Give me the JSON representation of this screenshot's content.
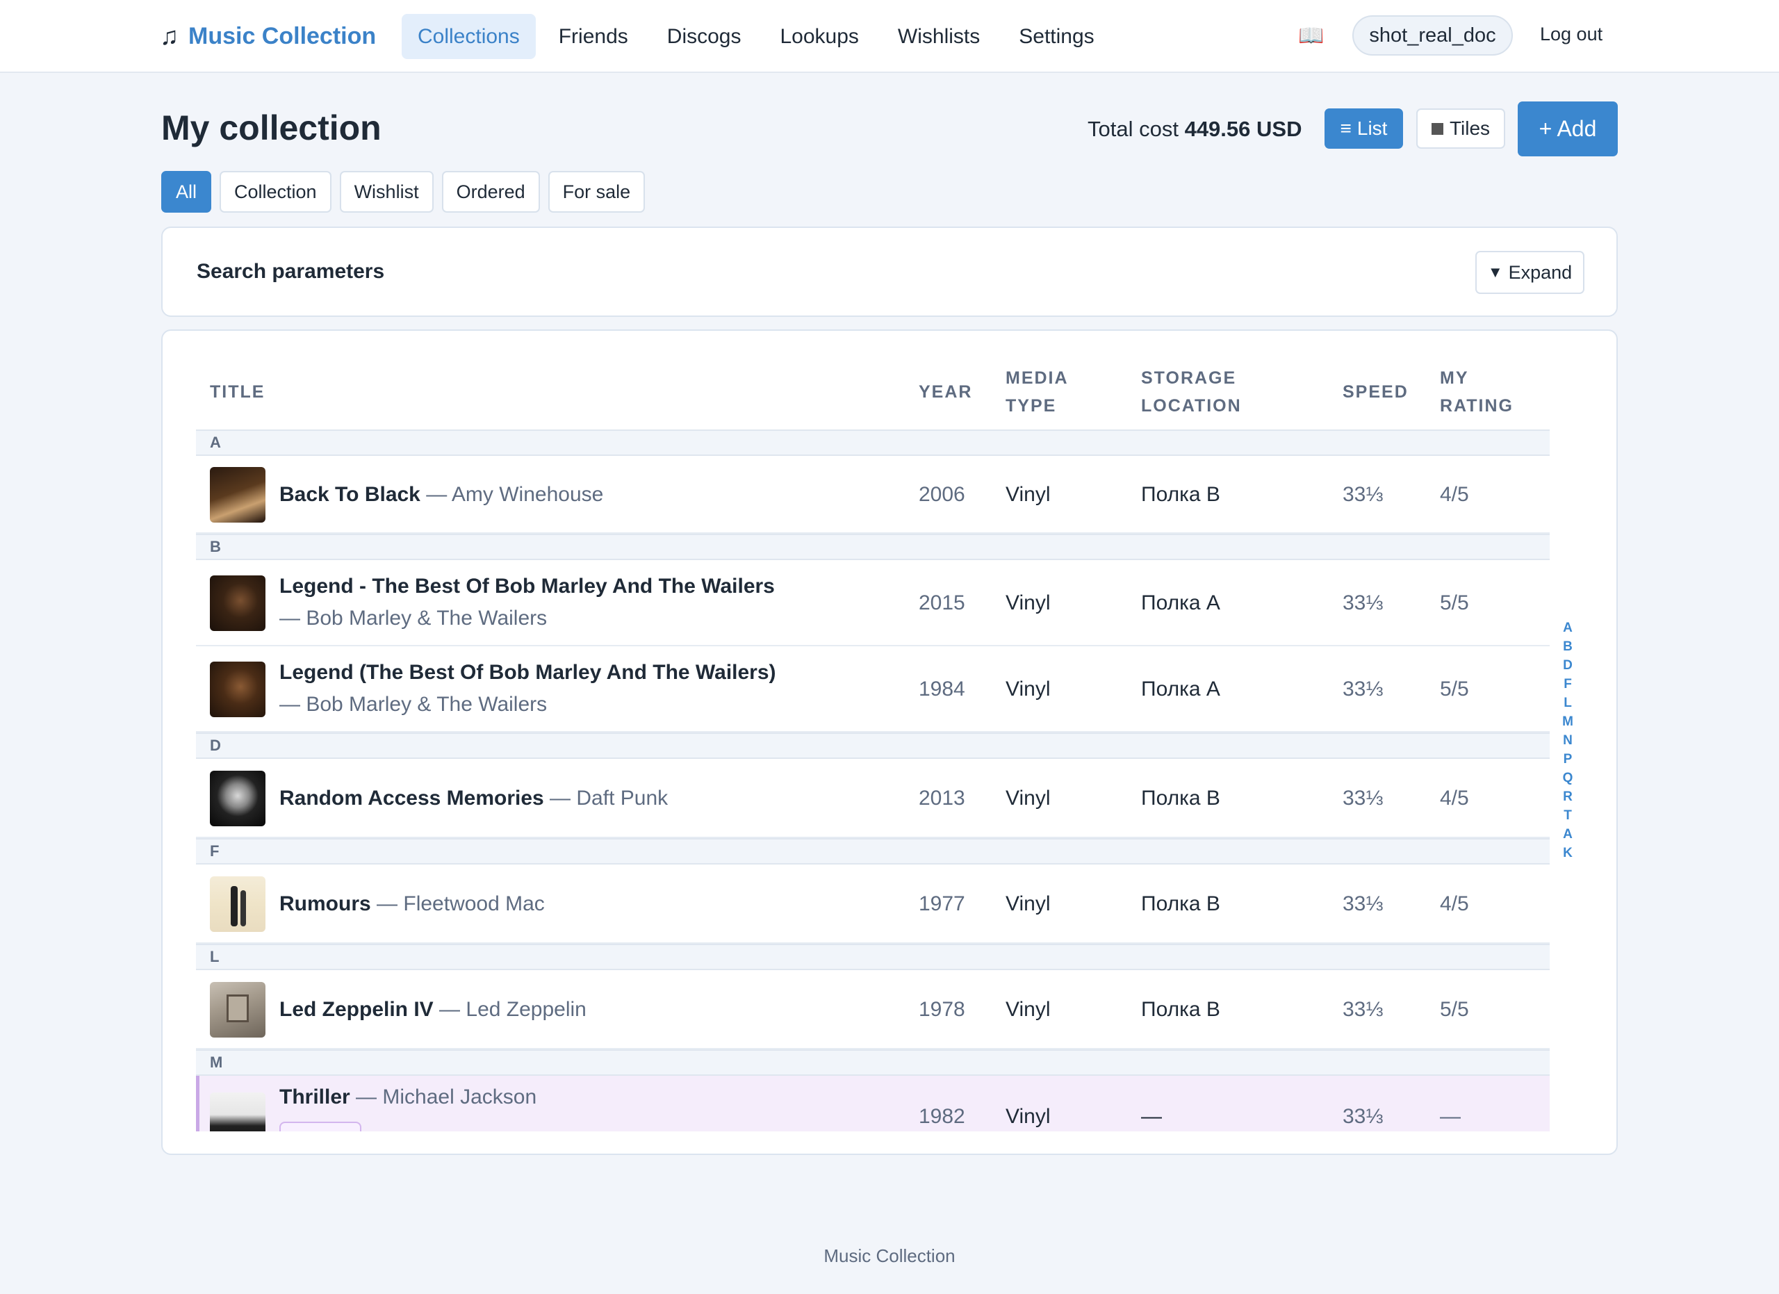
{
  "app": {
    "brand": "Music Collection",
    "brand_icon": "♫"
  },
  "nav": {
    "items": [
      {
        "label": "Collections",
        "active": true
      },
      {
        "label": "Friends",
        "active": false
      },
      {
        "label": "Discogs",
        "active": false
      },
      {
        "label": "Lookups",
        "active": false
      },
      {
        "label": "Wishlists",
        "active": false
      },
      {
        "label": "Settings",
        "active": false
      }
    ],
    "book_icon": "📖",
    "username": "shot_real_doc",
    "logout": "Log out"
  },
  "page": {
    "title": "My collection",
    "total_cost_label": "Total cost",
    "total_cost_value": "449.56 USD",
    "list_label": "List",
    "list_icon": "≡",
    "tiles_label": "Tiles",
    "add_label": "+ Add"
  },
  "filters": [
    {
      "label": "All",
      "active": true
    },
    {
      "label": "Collection",
      "active": false
    },
    {
      "label": "Wishlist",
      "active": false
    },
    {
      "label": "Ordered",
      "active": false
    },
    {
      "label": "For sale",
      "active": false
    }
  ],
  "search": {
    "title": "Search parameters",
    "expand_label": "Expand",
    "expand_icon": "▼"
  },
  "table": {
    "headers": {
      "title": "TITLE",
      "year": "YEAR",
      "media_1": "MEDIA",
      "media_2": "TYPE",
      "storage_1": "STORAGE",
      "storage_2": "LOCATION",
      "speed": "SPEED",
      "rating_1": "MY",
      "rating_2": "RATING"
    },
    "letters": [
      "A",
      "B",
      "D",
      "F",
      "L",
      "M"
    ],
    "rows": [
      {
        "title": "Back To Black",
        "artist": "Amy Winehouse",
        "year": "2006",
        "media": "Vinyl",
        "location": "Полка B",
        "speed": "33⅓",
        "rating": "4/5"
      },
      {
        "title": "Legend - The Best Of Bob Marley And The Wailers",
        "artist": "Bob Marley & The Wailers",
        "year": "2015",
        "media": "Vinyl",
        "location": "Полка A",
        "speed": "33⅓",
        "rating": "5/5"
      },
      {
        "title": "Legend (The Best Of Bob Marley And The Wailers)",
        "artist": "Bob Marley & The Wailers",
        "year": "1984",
        "media": "Vinyl",
        "location": "Полка A",
        "speed": "33⅓",
        "rating": "5/5"
      },
      {
        "title": "Random Access Memories",
        "artist": "Daft Punk",
        "year": "2013",
        "media": "Vinyl",
        "location": "Полка B",
        "speed": "33⅓",
        "rating": "4/5"
      },
      {
        "title": "Rumours",
        "artist": "Fleetwood Mac",
        "year": "1977",
        "media": "Vinyl",
        "location": "Полка B",
        "speed": "33⅓",
        "rating": "4/5"
      },
      {
        "title": "Led Zeppelin IV",
        "artist": "Led Zeppelin",
        "year": "1978",
        "media": "Vinyl",
        "location": "Полка B",
        "speed": "33⅓",
        "rating": "5/5"
      },
      {
        "title": "Thriller",
        "artist": "Michael Jackson",
        "year": "1982",
        "media": "Vinyl",
        "location": "—",
        "speed": "33⅓",
        "rating": "—"
      }
    ],
    "separator": "—"
  },
  "alpha_index": [
    "A",
    "B",
    "D",
    "F",
    "L",
    "M",
    "N",
    "P",
    "Q",
    "R",
    "T",
    "A",
    "K"
  ],
  "footer": "Music Collection"
}
